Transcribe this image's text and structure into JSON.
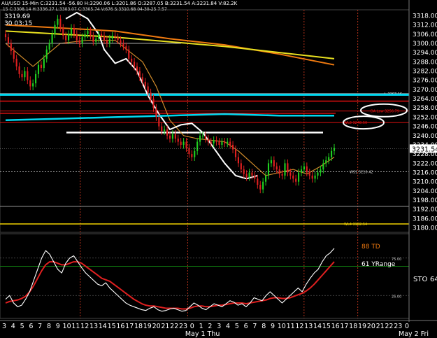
{
  "header": {
    "line1": "AU/USD  15-Min  C:3231.54  -56.80  H:3290.06  L:3201.86  O:3287.05  B:3231.54  A:3231.84  V:82.2K",
    "line2": ".15  C:3308.14 H:3336.27 L:3303.07  C:3305.74  V:676  S:3310.68  04-30-25  7:57",
    "hi_price": "3319.69",
    "hi_time": "30 03:15"
  },
  "price_axis": {
    "min": 3178,
    "max": 3320,
    "tick_labels": [
      "3318.00",
      "3312.00",
      "3306.00",
      "3300.00",
      "3294.00",
      "3288.00",
      "3282.00",
      "3276.00",
      "3270.00",
      "3264.00",
      "3258.00",
      "3252.00",
      "3246.00",
      "3240.00",
      "3234.00",
      "3228.00",
      "3222.00",
      "3216.00",
      "3210.00",
      "3204.00",
      "3198.00",
      "3192.00",
      "3186.00",
      "3180.00"
    ],
    "tick_values": [
      3318,
      3312,
      3306,
      3300,
      3294,
      3288,
      3282,
      3276,
      3270,
      3264,
      3258,
      3252,
      3246,
      3240,
      3234,
      3228,
      3222,
      3216,
      3210,
      3204,
      3198,
      3192,
      3186,
      3180
    ],
    "last_price_label": "3231.54",
    "last_price": 3231.54
  },
  "time_axis": {
    "labels": [
      "3",
      "4",
      "5",
      "6",
      "7",
      "8",
      "9",
      "10",
      "11",
      "12",
      "13",
      "14",
      "15",
      "16",
      "17",
      "18",
      "19",
      "20",
      "21",
      "22",
      "23",
      "0",
      "1",
      "2",
      "3",
      "4",
      "5",
      "6",
      "7",
      "8",
      "9",
      "10",
      "11",
      "12",
      "13",
      "14",
      "15",
      "16",
      "17",
      "18",
      "19",
      "20",
      "21",
      "22",
      "23",
      "0"
    ],
    "day_labels": [
      {
        "text": "May 1 Thu",
        "index": 21
      },
      {
        "text": "May 2 Fri",
        "index": 46
      }
    ],
    "vertical_lines": [
      8.5,
      20.5,
      33.5,
      39.5
    ]
  },
  "levels": [
    {
      "name": "L",
      "label": "L  3267.16",
      "price": 3267.16,
      "color": "#ffffff"
    },
    {
      "name": "cyan_top",
      "label": "",
      "price": 3266.6,
      "color": "#00d8f0"
    },
    {
      "name": "red_top",
      "label": "",
      "price": 3262.4,
      "color": "#e01010"
    },
    {
      "name": "DA_Low",
      "label": "DA Low  3256.79",
      "price": 3256.0,
      "color": "#e01010"
    },
    {
      "name": "red_mid",
      "label": "",
      "price": 3254.5,
      "color": "#e01010"
    },
    {
      "name": "WL3",
      "label": "WL3  3248.50",
      "price": 3248.5,
      "color": "#e01010"
    },
    {
      "name": "white_level",
      "label": "",
      "price": 3242.0,
      "color": "#ffffff"
    },
    {
      "name": "WS1",
      "label": "WS1  3216.42",
      "price": 3216.42,
      "color": "#cccccc"
    },
    {
      "name": "gray_level",
      "label": "",
      "price": 3194.0,
      "color": "#9a9a9a"
    },
    {
      "name": "WL4",
      "label": "WL4  3182.54",
      "price": 3182.54,
      "color": "#f0d000"
    }
  ],
  "price_series": {
    "x": [
      0,
      1,
      2,
      3,
      4,
      5,
      6,
      7,
      8,
      9,
      10,
      11,
      12,
      13,
      14,
      15,
      16,
      17,
      18,
      19,
      20,
      21,
      22,
      23,
      24,
      25,
      26,
      27,
      28,
      29,
      30,
      31,
      32,
      33,
      34,
      35,
      36,
      37,
      38,
      39,
      40,
      41,
      42,
      43,
      44,
      45,
      46,
      47,
      48,
      49,
      50,
      51,
      52,
      53,
      54,
      55,
      56,
      57,
      58,
      59,
      60,
      61,
      62,
      63,
      64,
      65,
      66,
      67,
      68,
      69,
      70,
      71,
      72,
      73,
      74,
      75,
      76,
      77,
      78,
      79,
      80,
      81,
      82,
      83,
      84,
      85,
      86,
      87,
      88,
      89,
      90,
      91,
      92,
      93,
      94,
      95,
      96,
      97,
      98,
      99,
      100,
      101,
      102,
      103,
      104,
      105,
      106,
      107,
      108,
      109,
      110,
      111,
      112,
      113,
      114,
      115,
      116,
      117,
      118,
      119,
      120,
      121,
      122,
      123,
      124,
      125,
      126,
      127,
      128,
      129,
      130,
      131,
      132,
      133,
      134,
      135,
      136,
      137,
      138,
      139,
      140,
      141,
      142,
      143,
      144,
      145,
      146,
      147,
      148,
      149,
      150,
      151,
      152,
      153,
      154,
      155,
      156,
      157,
      158,
      159,
      160,
      161,
      162,
      163,
      164,
      165,
      166,
      167,
      168,
      169,
      170,
      171,
      172,
      173,
      174,
      175,
      176,
      177,
      178,
      179,
      180,
      181,
      182,
      183
    ],
    "close": [
      3304,
      3300,
      3295,
      3290,
      3285,
      3280,
      3278,
      3282,
      3276,
      3272,
      3274,
      3280,
      3286,
      3284,
      3290,
      3296,
      3300,
      3306,
      3312,
      3316,
      3310,
      3305,
      3302,
      3306,
      3310,
      3306,
      3302,
      3300,
      3304,
      3306,
      3308,
      3305,
      3301,
      3303,
      3306,
      3305,
      3302,
      3300,
      3303,
      3305,
      3304,
      3302,
      3300,
      3298,
      3296,
      3290,
      3288,
      3285,
      3282,
      3278,
      3275,
      3272,
      3268,
      3264,
      3258,
      3252,
      3246,
      3243,
      3244,
      3240,
      3238,
      3241,
      3238,
      3236,
      3234,
      3236,
      3232,
      3228,
      3226,
      3230,
      3236,
      3240,
      3240,
      3238,
      3236,
      3235,
      3237,
      3236,
      3234,
      3236,
      3235,
      3236,
      3234,
      3231,
      3226,
      3222,
      3218,
      3215,
      3213,
      3216,
      3214,
      3212,
      3208,
      3205,
      3210,
      3214,
      3222,
      3224,
      3220,
      3218,
      3215,
      3214,
      3222,
      3216,
      3214,
      3212,
      3210,
      3216,
      3218,
      3220,
      3216,
      3214,
      3212,
      3214,
      3216,
      3218,
      3222,
      3224,
      3226,
      3230,
      3232
    ]
  },
  "moving_averages": [
    {
      "name": "orange_fast",
      "color": "#d08a2a",
      "points": [
        [
          0,
          3300
        ],
        [
          10,
          3285
        ],
        [
          20,
          3300
        ],
        [
          30,
          3302
        ],
        [
          40,
          3302
        ],
        [
          50,
          3288
        ],
        [
          55,
          3272
        ],
        [
          60,
          3250
        ],
        [
          65,
          3240
        ],
        [
          70,
          3238
        ],
        [
          80,
          3236
        ],
        [
          85,
          3230
        ],
        [
          90,
          3222
        ],
        [
          95,
          3214
        ],
        [
          100,
          3216
        ],
        [
          105,
          3218
        ],
        [
          110,
          3215
        ],
        [
          115,
          3220
        ],
        [
          120,
          3226
        ]
      ]
    },
    {
      "name": "white_curve",
      "color": "#ffffff",
      "points": [
        [
          22,
          3316
        ],
        [
          26,
          3320
        ],
        [
          30,
          3316
        ],
        [
          34,
          3306
        ],
        [
          36,
          3296
        ],
        [
          40,
          3287
        ],
        [
          44,
          3290
        ],
        [
          48,
          3282
        ],
        [
          52,
          3266
        ],
        [
          56,
          3254
        ],
        [
          60,
          3244
        ],
        [
          64,
          3247
        ],
        [
          68,
          3248
        ],
        [
          72,
          3242
        ],
        [
          76,
          3232
        ],
        [
          80,
          3222
        ],
        [
          84,
          3214
        ],
        [
          88,
          3212
        ],
        [
          92,
          3214
        ]
      ]
    },
    {
      "name": "orange_slow",
      "color": "#f07a10",
      "points": [
        [
          0,
          3312
        ],
        [
          20,
          3310
        ],
        [
          40,
          3308
        ],
        [
          60,
          3303
        ],
        [
          80,
          3299
        ],
        [
          100,
          3293
        ],
        [
          120,
          3286
        ]
      ]
    },
    {
      "name": "yellow_slow",
      "color": "#e8e020",
      "points": [
        [
          0,
          3308
        ],
        [
          20,
          3306
        ],
        [
          40,
          3304
        ],
        [
          60,
          3301
        ],
        [
          80,
          3298
        ],
        [
          100,
          3294
        ],
        [
          120,
          3290
        ]
      ]
    },
    {
      "name": "cyan_band",
      "color": "#00d8f0",
      "points": [
        [
          0,
          3250
        ],
        [
          20,
          3251
        ],
        [
          40,
          3252
        ],
        [
          60,
          3253
        ],
        [
          80,
          3254
        ],
        [
          100,
          3253
        ],
        [
          120,
          3253
        ]
      ]
    },
    {
      "name": "white_top_line",
      "color": "#cccccc",
      "points": [
        [
          0,
          3300
        ],
        [
          64,
          3300
        ]
      ]
    }
  ],
  "oscillator": {
    "title_td": "88 TD",
    "title_yrange": "61 YRange",
    "label_sto": "STO",
    "label_64": "64",
    "levels": [
      75,
      25
    ],
    "level_labels": [
      "75.00",
      "25.00"
    ],
    "ylim": [
      0,
      100
    ],
    "white": [
      20,
      25,
      15,
      10,
      12,
      20,
      30,
      45,
      60,
      75,
      85,
      80,
      70,
      60,
      55,
      68,
      75,
      78,
      70,
      62,
      55,
      50,
      45,
      40,
      38,
      42,
      35,
      30,
      25,
      20,
      15,
      12,
      10,
      8,
      6,
      5,
      8,
      10,
      6,
      4,
      5,
      7,
      8,
      6,
      4,
      5,
      10,
      15,
      12,
      8,
      6,
      10,
      14,
      12,
      10,
      14,
      18,
      16,
      12,
      14,
      10,
      15,
      22,
      20,
      18,
      25,
      30,
      25,
      20,
      15,
      20,
      25,
      30,
      35,
      30,
      40,
      48,
      55,
      60,
      70,
      78,
      82,
      88
    ],
    "red": [
      15,
      17,
      18,
      19,
      21,
      24,
      30,
      38,
      48,
      58,
      66,
      70,
      70,
      68,
      66,
      66,
      68,
      70,
      70,
      68,
      64,
      60,
      56,
      52,
      48,
      46,
      44,
      40,
      36,
      32,
      28,
      24,
      20,
      17,
      14,
      12,
      11,
      11,
      10,
      9,
      8,
      8,
      8,
      8,
      7,
      7,
      8,
      10,
      11,
      11,
      10,
      10,
      11,
      12,
      12,
      13,
      14,
      15,
      15,
      15,
      14,
      15,
      16,
      17,
      18,
      19,
      21,
      22,
      22,
      21,
      21,
      22,
      24,
      26,
      28,
      31,
      35,
      40,
      46,
      52,
      58,
      64,
      70
    ]
  },
  "colors": {
    "background": "#000000",
    "grid_dotted": "#555555",
    "vline": "#b0301a",
    "up_candle": "#20d020",
    "down_candle": "#e02020",
    "osc_red": "#e02020",
    "osc_white": "#ffffff",
    "osc_green_line": "#108010",
    "last_price_bg": "#ffffff"
  },
  "chart_data": {
    "type": "line",
    "title": "AU/USD 15-Min",
    "ylabel": "",
    "xlabel": "",
    "ylim": [
      3178,
      3320
    ],
    "x_ticks": [
      "3",
      "4",
      "5",
      "6",
      "7",
      "8",
      "9",
      "10",
      "11",
      "12",
      "13",
      "14",
      "15",
      "16",
      "17",
      "18",
      "19",
      "20",
      "21",
      "22",
      "23",
      "0",
      "1",
      "2",
      "3",
      "4",
      "5",
      "6",
      "7",
      "8",
      "9",
      "10",
      "11",
      "12",
      "13",
      "14",
      "15",
      "16",
      "17",
      "18",
      "19",
      "20",
      "21",
      "22",
      "23",
      "0"
    ],
    "series": [
      {
        "name": "Close",
        "values": [
          3304,
          3296,
          3280,
          3278,
          3290,
          3310,
          3304,
          3300,
          3294,
          3270,
          3244,
          3238,
          3228,
          3240,
          3236,
          3226,
          3208,
          3218,
          3214,
          3222,
          3232
        ]
      }
    ]
  }
}
